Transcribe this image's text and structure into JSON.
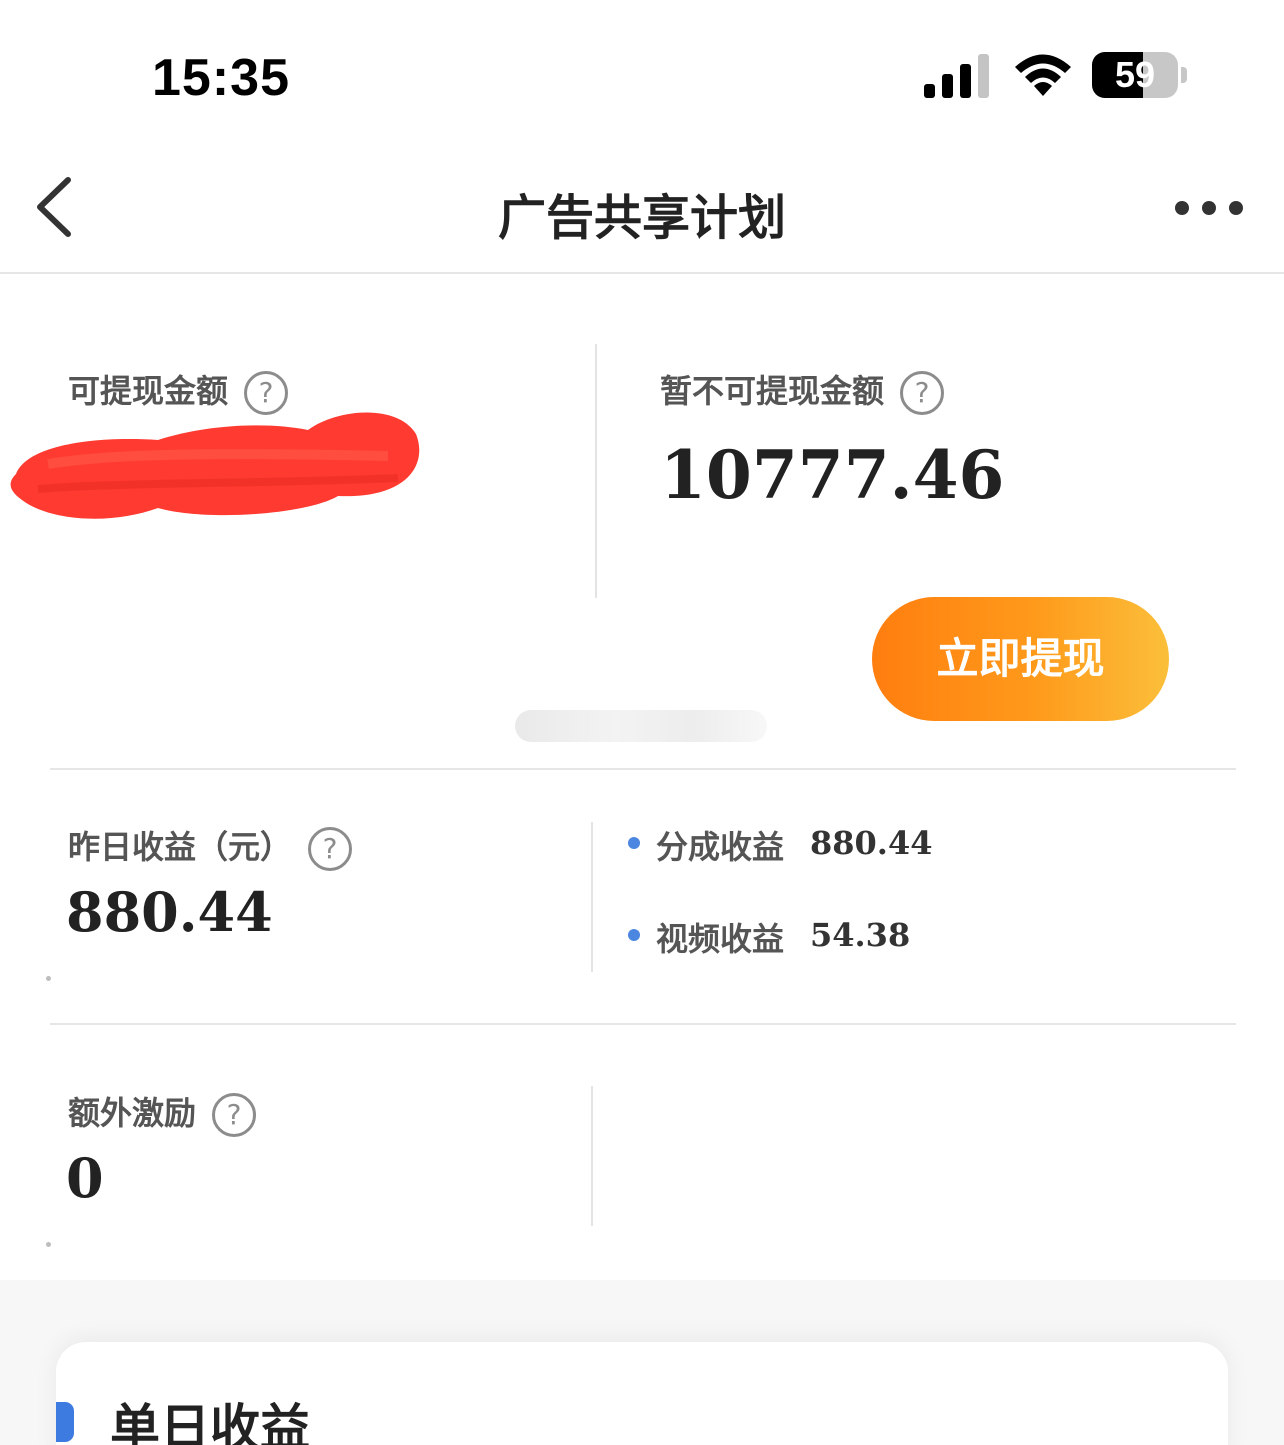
{
  "status_bar": {
    "time": "15:35",
    "battery_level": "59",
    "battery_fraction": 0.59
  },
  "nav": {
    "title": "广告共享计划",
    "back_icon": "chevron-left-icon",
    "more_icon": "more-horizontal-icon"
  },
  "balance": {
    "withdrawable_label": "可提现金额",
    "pending_label": "暂不可提现金额",
    "pending_value": "10777.46",
    "withdraw_button": "立即提现",
    "help_glyph": "?"
  },
  "yesterday": {
    "label": "昨日收益（元）",
    "value": "880.44",
    "items": [
      {
        "label": "分成收益",
        "value": "880.44"
      },
      {
        "label": "视频收益",
        "value": "54.38"
      }
    ]
  },
  "extra": {
    "label": "额外激励",
    "value": "0"
  },
  "daily": {
    "title": "单日收益"
  },
  "colors": {
    "accent_blue": "#4b86e0",
    "button_orange": "#ff8a14",
    "redaction_red": "#ff3a30"
  }
}
